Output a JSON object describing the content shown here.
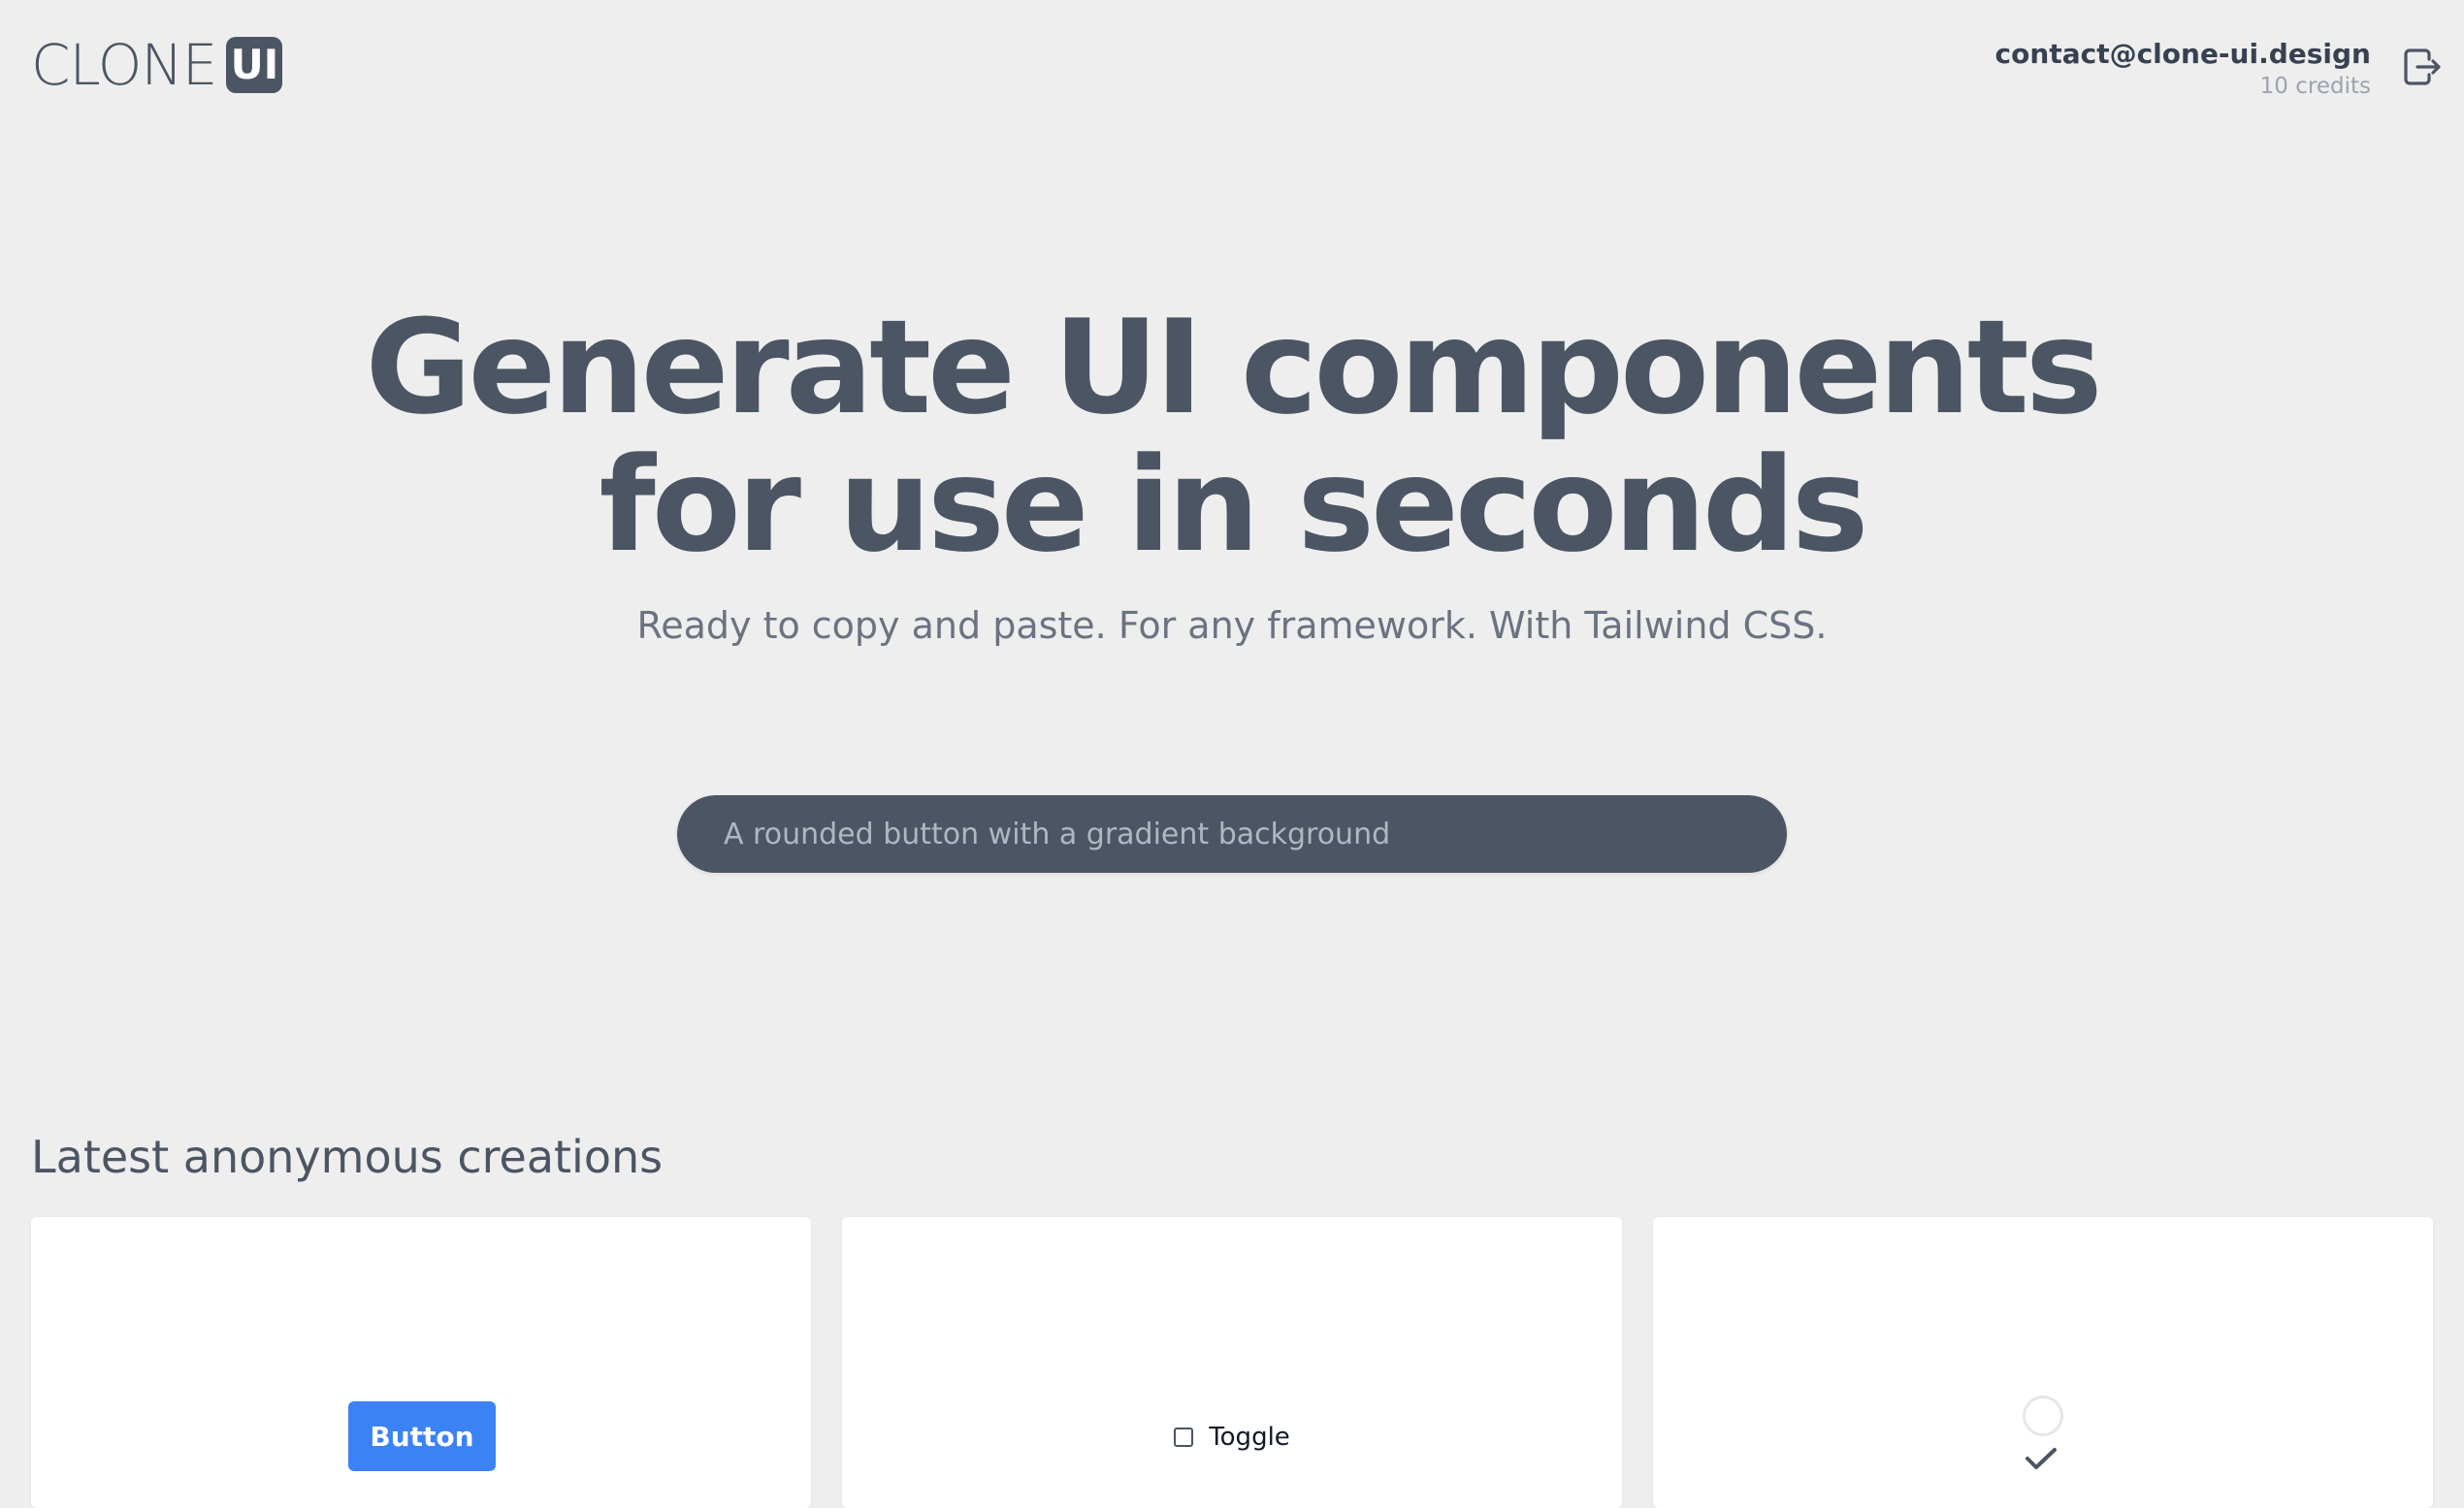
{
  "header": {
    "logo_text": "CLONE",
    "logo_badge": "UI",
    "user_email": "contact@clone-ui.design",
    "credits": "10 credits"
  },
  "hero": {
    "title_line1": "Generate UI components",
    "title_line2": "for use in seconds",
    "subtitle": "Ready to copy and paste. For any framework. With Tailwind CSS.",
    "prompt_placeholder": "A rounded button with a gradient background"
  },
  "latest": {
    "title": "Latest anonymous creations",
    "cards": [
      {
        "preview_label": "Button",
        "accent": "#3b82f6"
      },
      {
        "preview_label": "Toggle"
      },
      {
        "preview_icons": [
          "spinner-icon",
          "check-icon"
        ]
      }
    ]
  },
  "colors": {
    "background": "#eeeeee",
    "primary_text": "#4b5563",
    "muted_text": "#9ca3af",
    "button_blue": "#3b82f6"
  }
}
